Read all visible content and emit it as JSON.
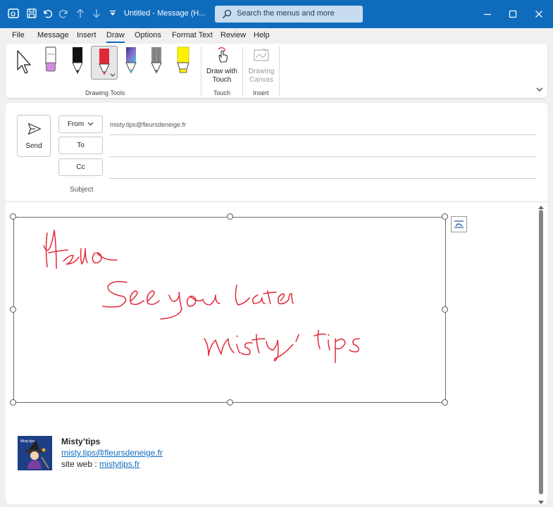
{
  "titlebar": {
    "title": "Untitled  -  Message (H...",
    "search_placeholder": "Search the menus and more",
    "accent": "#0f6cbd"
  },
  "menubar": {
    "items": [
      "File",
      "Message",
      "Insert",
      "Draw",
      "Options",
      "Format Text",
      "Review",
      "Help"
    ],
    "active": "Draw"
  },
  "ribbon": {
    "groups": [
      {
        "label": "Drawing Tools"
      },
      {
        "label": "Touch",
        "button": [
          "Draw with",
          "Touch"
        ]
      },
      {
        "label": "Insert",
        "button": [
          "Drawing",
          "Canvas"
        ]
      }
    ]
  },
  "compose": {
    "send_label": "Send",
    "from_label": "From",
    "from_address": "misty.tips@fleursdeneige.fr",
    "to_label": "To",
    "cc_label": "Cc",
    "subject_label": "Subject",
    "ink_color": "#e0283a"
  },
  "signature": {
    "name": "Misty’tips",
    "email": "misty.tips@fleursdeneige.fr",
    "web_label": "site web : ",
    "web_link": "mistytips.fr"
  }
}
